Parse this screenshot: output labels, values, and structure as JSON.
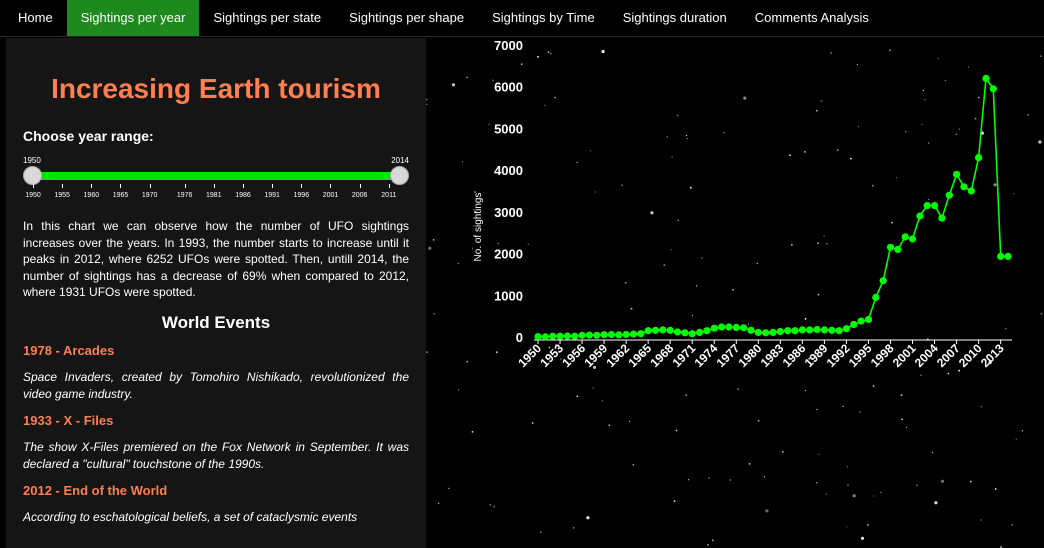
{
  "nav": {
    "items": [
      {
        "label": "Home",
        "active": false
      },
      {
        "label": "Sightings per year",
        "active": true
      },
      {
        "label": "Sightings per state",
        "active": false
      },
      {
        "label": "Sightings per shape",
        "active": false
      },
      {
        "label": "Sightings by Time",
        "active": false
      },
      {
        "label": "Sightings duration",
        "active": false
      },
      {
        "label": "Comments Analysis",
        "active": false
      }
    ],
    "active_color": "#1e8a1e"
  },
  "sidebar": {
    "title": "Increasing Earth tourism",
    "range_label": "Choose year range:",
    "slider": {
      "min_label": "1950",
      "max_label": "2014",
      "ticks": [
        "1950",
        "1955",
        "1960",
        "1965",
        "1970",
        "1976",
        "1981",
        "1986",
        "1991",
        "1996",
        "2001",
        "2006",
        "2011"
      ]
    },
    "description": "In this chart we can observe how the number of UFO sightings increases over the years. In 1993, the number starts to increase until it peaks in 2012, where 6252 UFOs were spotted. Then, untill 2014, the number of sightings has a decrease of 69% when compared to 2012, where 1931 UFOs were spotted.",
    "events_title": "World Events",
    "events": [
      {
        "title": "1978 - Arcades",
        "text": "Space Invaders, created by Tomohiro Nishikado, revolutionized the video game industry."
      },
      {
        "title": "1933 - X - Files",
        "text": "The show X-Files premiered on the Fox Network in September. It was declared a \"cultural\" touchstone of the 1990s."
      },
      {
        "title": "2012 - End of the World",
        "text": "According to eschatological beliefs, a set of cataclysmic events"
      }
    ],
    "accent_color": "#ff7f50"
  },
  "chart_data": {
    "type": "line",
    "ylabel": "No. of sightings",
    "ylim": [
      0,
      7000
    ],
    "y_ticks": [
      "0",
      "1000",
      "2000",
      "3000",
      "4000",
      "5000",
      "6000",
      "7000"
    ],
    "x_ticks": [
      "1950",
      "1953",
      "1956",
      "1959",
      "1962",
      "1965",
      "1968",
      "1971",
      "1974",
      "1977",
      "1980",
      "1983",
      "1986",
      "1989",
      "1992",
      "1995",
      "1998",
      "2001",
      "2004",
      "2007",
      "2010",
      "2013"
    ],
    "line_color": "#00ff00",
    "series": [
      {
        "x": [
          1950,
          1951,
          1952,
          1953,
          1954,
          1955,
          1956,
          1957,
          1958,
          1959,
          1960,
          1961,
          1962,
          1963,
          1964,
          1965,
          1966,
          1967,
          1968,
          1969,
          1970,
          1971,
          1972,
          1973,
          1974,
          1975,
          1976,
          1977,
          1978,
          1979,
          1980,
          1981,
          1982,
          1983,
          1984,
          1985,
          1986,
          1987,
          1988,
          1989,
          1990,
          1991,
          1992,
          1993,
          1994,
          1995,
          1996,
          1997,
          1998,
          1999,
          2000,
          2001,
          2002,
          2003,
          2004,
          2005,
          2006,
          2007,
          2008,
          2009,
          2010,
          2011,
          2012,
          2013,
          2014
        ],
        "values": [
          10,
          5,
          20,
          20,
          25,
          20,
          40,
          45,
          40,
          55,
          60,
          50,
          60,
          70,
          80,
          150,
          160,
          170,
          160,
          120,
          100,
          80,
          110,
          150,
          210,
          240,
          240,
          230,
          220,
          160,
          110,
          100,
          110,
          130,
          150,
          150,
          170,
          170,
          180,
          170,
          160,
          150,
          200,
          300,
          380,
          420,
          950,
          1350,
          2150,
          2100,
          2400,
          2350,
          2900,
          3150,
          3150,
          2850,
          3400,
          3900,
          3600,
          3500,
          4300,
          6200,
          5950,
          1931,
          1931
        ]
      }
    ]
  }
}
